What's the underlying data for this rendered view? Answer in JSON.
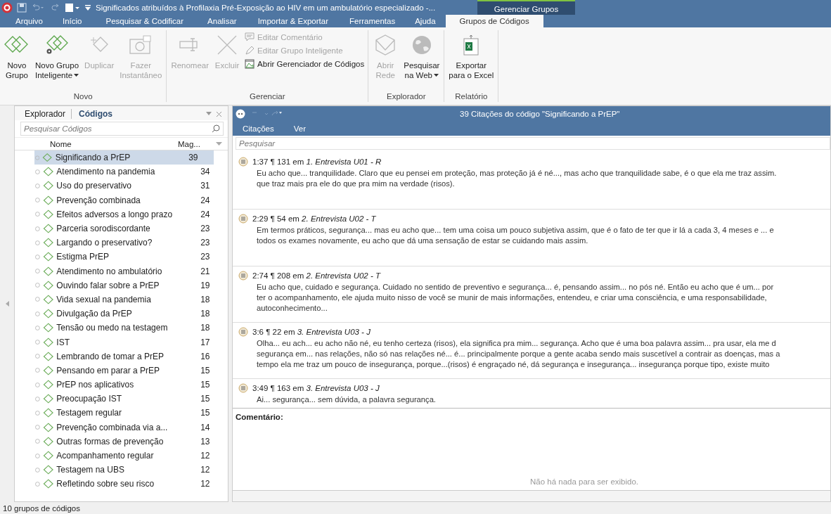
{
  "window": {
    "title": "Significados atribuídos à Profilaxia Pré-Exposição ao HIV em um ambulatório especializado -...",
    "context_tab": "Gerenciar Grupos"
  },
  "menu": [
    {
      "label": "Arquivo",
      "selected": false
    },
    {
      "label": "Início",
      "selected": false
    },
    {
      "label": "Pesquisar & Codificar",
      "selected": false
    },
    {
      "label": "Analisar",
      "selected": false
    },
    {
      "label": "Importar & Exportar",
      "selected": false
    },
    {
      "label": "Ferramentas",
      "selected": false
    },
    {
      "label": "Ajuda",
      "selected": false
    },
    {
      "label": "Grupos de Códigos",
      "selected": true
    }
  ],
  "ribbon": [
    {
      "label": "Novo",
      "items": [
        {
          "kind": "new-group",
          "label": "Novo\nGrupo",
          "disabled": false
        },
        {
          "kind": "smart-group",
          "label": "Novo Grupo\nInteligente",
          "disabled": false,
          "dropdown": true
        },
        {
          "kind": "duplicate",
          "label": "Duplicar",
          "disabled": true
        },
        {
          "kind": "camera",
          "label": "Fazer\nInstantâneo",
          "disabled": true
        }
      ]
    },
    {
      "label": "Gerenciar",
      "items": [
        {
          "kind": "rename",
          "label": "Renomear",
          "disabled": true
        },
        {
          "kind": "delete",
          "label": "Excluir",
          "disabled": true
        },
        {
          "kind": "stack",
          "small": [
            {
              "kind": "comment",
              "label": "Editar Comentário",
              "disabled": true
            },
            {
              "kind": "smart-edit",
              "label": "Editar Grupo Inteligente",
              "disabled": true
            },
            {
              "kind": "manager",
              "label": "Abrir Gerenciador de Códigos",
              "disabled": false
            }
          ]
        }
      ]
    },
    {
      "label": "Explorador",
      "items": [
        {
          "kind": "network",
          "label": "Abrir\nRede",
          "disabled": true
        },
        {
          "kind": "globe",
          "label": "Pesquisar\nna Web",
          "disabled": false,
          "dropdown": true
        }
      ]
    },
    {
      "label": "Relatório",
      "items": [
        {
          "kind": "excel",
          "label": "Exportar\npara o Excel",
          "disabled": false
        }
      ]
    }
  ],
  "codes_panel": {
    "tabs": [
      {
        "label": "Explorador",
        "selected": false
      },
      {
        "label": "Códigos",
        "selected": true
      }
    ],
    "search": {
      "placeholder": "Pesquisar Códigos"
    },
    "columns": [
      "Nome",
      "Mag..."
    ],
    "rows": [
      {
        "name": "Significando a PrEP",
        "count": "39",
        "selected": true
      },
      {
        "name": "Atendimento na pandemia",
        "count": "34",
        "selected": false
      },
      {
        "name": "Uso do preservativo",
        "count": "31",
        "selected": false
      },
      {
        "name": "Prevenção combinada",
        "count": "24",
        "selected": false
      },
      {
        "name": "Efeitos adversos a longo prazo",
        "count": "24",
        "selected": false
      },
      {
        "name": "Parceria sorodiscordante",
        "count": "23",
        "selected": false
      },
      {
        "name": "Largando o preservativo?",
        "count": "23",
        "selected": false
      },
      {
        "name": "Estigma PrEP",
        "count": "23",
        "selected": false
      },
      {
        "name": "Atendimento no ambulatório",
        "count": "21",
        "selected": false
      },
      {
        "name": "Ouvindo falar sobre a PrEP",
        "count": "19",
        "selected": false
      },
      {
        "name": "Vida sexual na pandemia",
        "count": "18",
        "selected": false
      },
      {
        "name": "Divulgação da PrEP",
        "count": "18",
        "selected": false
      },
      {
        "name": "Tensão ou medo na testagem",
        "count": "18",
        "selected": false
      },
      {
        "name": "IST",
        "count": "17",
        "selected": false
      },
      {
        "name": "Lembrando de tomar a PrEP",
        "count": "16",
        "selected": false
      },
      {
        "name": "Pensando em parar a PrEP",
        "count": "15",
        "selected": false
      },
      {
        "name": "PrEP nos aplicativos",
        "count": "15",
        "selected": false
      },
      {
        "name": "Preocupação IST",
        "count": "15",
        "selected": false
      },
      {
        "name": "Testagem regular",
        "count": "15",
        "selected": false
      },
      {
        "name": "Prevenção combinada via a...",
        "count": "14",
        "selected": false
      },
      {
        "name": "Outras formas de prevenção",
        "count": "13",
        "selected": false
      },
      {
        "name": "Acompanhamento regular",
        "count": "12",
        "selected": false
      },
      {
        "name": "Testagem na UBS",
        "count": "12",
        "selected": false
      },
      {
        "name": "Refletindo sobre seu risco",
        "count": "12",
        "selected": false
      }
    ]
  },
  "quotations": {
    "title": "39 Citações do código \"Significando a PrEP\"",
    "tabs": [
      "Citações",
      "Ver"
    ],
    "search": {
      "placeholder": "Pesquisar"
    },
    "items": [
      {
        "ref": "1:37 ¶ 131 em *1. Entrevista U01 - R*",
        "lines": [
          "Eu acho que... tranquilidade. Claro que eu pensei em proteção, mas proteção já é né..., mas acho que tranquilidade sabe, é o que ela me traz assim.",
          "que traz mais pra ele do que pra mim na verdade (risos)."
        ]
      },
      {
        "ref": "2:29 ¶ 54 em *2. Entrevista U02 - T*",
        "lines": [
          "Em termos práticos, segurança... mas eu acho que... tem uma coisa um pouco subjetiva assim, que é o fato de ter que ir lá a cada 3, 4 meses e ... e",
          "todos os exames novamente, eu acho que dá uma sensação de estar se cuidando mais assim."
        ]
      },
      {
        "ref": "2:74 ¶ 208 em *2. Entrevista U02 - T*",
        "lines": [
          "Eu acho que, cuidado e segurança. Cuidado no sentido de preventivo e segurança... é, pensando assim... no pós né. Então eu acho que é um... por",
          "ter o acompanhamento, ele ajuda muito nisso de você se munir de mais informações, entendeu, e criar uma consciência, e uma responsabilidade,",
          "autoconhecimento..."
        ]
      },
      {
        "ref": "3:6 ¶ 22 em *3. Entrevista U03 - J*",
        "lines": [
          "Olha... eu ach... eu acho não né, eu tenho certeza (risos), ela significa pra mim... segurança. Acho que é uma boa palavra assim... pra usar, ela me d",
          "segurança em... nas relações, não só nas relações né... é... principalmente porque a gente acaba sendo mais suscetível a contrair as doenças, mas a",
          "tempo ela me traz um pouco de insegurança, porque...(risos) é engraçado né, dá segurança e insegurança... insegurança porque tipo, existe muito"
        ]
      },
      {
        "ref": "3:49 ¶ 163 em *3. Entrevista U03 - J*",
        "lines": [
          "Ai... segurança... sem dúvida, a palavra segurança."
        ]
      }
    ],
    "comment_label": "Comentário:",
    "comment_empty": "Não há nada para ser exibido."
  },
  "status_bar": "10 grupos de códigos"
}
